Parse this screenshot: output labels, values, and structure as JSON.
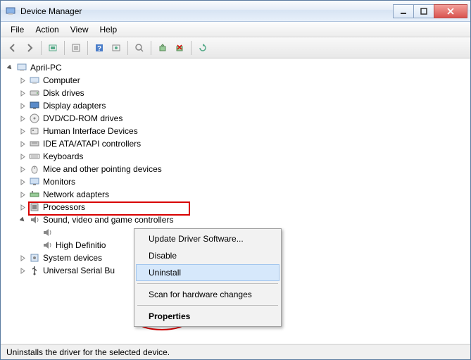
{
  "window": {
    "title": "Device Manager"
  },
  "menubar": [
    "File",
    "Action",
    "View",
    "Help"
  ],
  "tree": {
    "root": "April-PC",
    "categories": [
      "Computer",
      "Disk drives",
      "Display adapters",
      "DVD/CD-ROM drives",
      "Human Interface Devices",
      "IDE ATA/ATAPI controllers",
      "Keyboards",
      "Mice and other pointing devices",
      "Monitors",
      "Network adapters",
      "Processors",
      "Sound, video and game controllers",
      "System devices",
      "Universal Serial Bu"
    ],
    "sound_children": [
      "",
      "High Definitio"
    ]
  },
  "context_menu": {
    "items": [
      "Update Driver Software...",
      "Disable",
      "Uninstall",
      "Scan for hardware changes",
      "Properties"
    ],
    "hovered_index": 2,
    "bold_index": 4
  },
  "statusbar": "Uninstalls the driver for the selected device."
}
